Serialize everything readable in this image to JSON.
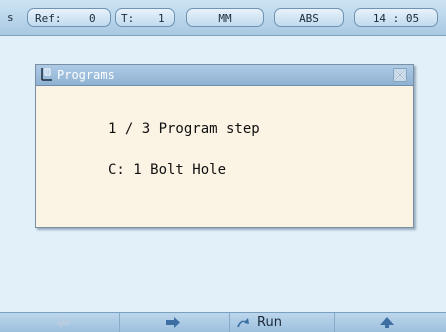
{
  "status_bar": {
    "mode": "s",
    "ref_label": "Ref:",
    "ref_value": "0",
    "tool_label": "T:",
    "tool_value": "1",
    "units": "MM",
    "coord_mode": "ABS",
    "time": "14 : 05"
  },
  "dialog": {
    "title": "Programs",
    "close_icon": "close-x-icon",
    "line1": "1 / 3 Program step",
    "line2": "C: 1 Bolt Hole"
  },
  "softkeys": {
    "back_icon": "arrow-left-icon",
    "forward_icon": "arrow-right-icon",
    "run_icon": "run-icon",
    "run_label": "Run",
    "up_icon": "up-arrow-icon"
  },
  "colors": {
    "background": "#e2f0f9",
    "titlebar": "#9dbedc",
    "dialog_bg": "#fbf3e4",
    "arrow_active": "#3d6fa3",
    "arrow_disabled": "#b6cde1"
  }
}
